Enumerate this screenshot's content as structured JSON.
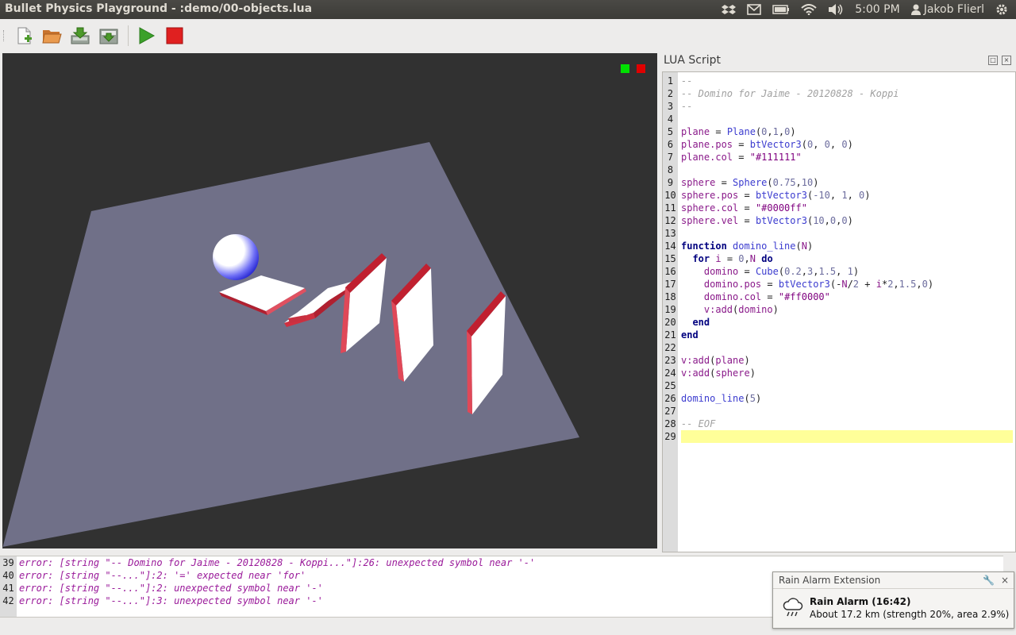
{
  "window": {
    "title": "Bullet Physics Playground - :demo/00-objects.lua"
  },
  "tray": {
    "time": "5:00 PM",
    "user": "Jakob Flierl"
  },
  "toolbar": {
    "buttons": [
      "new-file-icon",
      "open-folder-icon",
      "save-icon",
      "save-as-icon",
      "run-icon",
      "stop-icon"
    ]
  },
  "viewport": {
    "status_colors": [
      "#00ff00",
      "#ff0000"
    ],
    "plane_color": "#6f6f86",
    "sphere_color": "#0000ff",
    "domino_color": "#ff0000"
  },
  "script_panel": {
    "title": "LUA Script",
    "current_line": 29,
    "lines": [
      [
        {
          "c": "com",
          "t": "--"
        }
      ],
      [
        {
          "c": "com",
          "t": "-- Domino for Jaime - 20120828 - Koppi"
        }
      ],
      [
        {
          "c": "com",
          "t": "--"
        }
      ],
      [],
      [
        {
          "c": "id",
          "t": "plane"
        },
        {
          "c": "plain",
          "t": " = "
        },
        {
          "c": "fn",
          "t": "Plane"
        },
        {
          "c": "plain",
          "t": "("
        },
        {
          "c": "num",
          "t": "0"
        },
        {
          "c": "plain",
          "t": ","
        },
        {
          "c": "num",
          "t": "1"
        },
        {
          "c": "plain",
          "t": ","
        },
        {
          "c": "num",
          "t": "0"
        },
        {
          "c": "plain",
          "t": ")"
        }
      ],
      [
        {
          "c": "id",
          "t": "plane.pos"
        },
        {
          "c": "plain",
          "t": " = "
        },
        {
          "c": "fn",
          "t": "btVector3"
        },
        {
          "c": "plain",
          "t": "("
        },
        {
          "c": "num",
          "t": "0"
        },
        {
          "c": "plain",
          "t": ", "
        },
        {
          "c": "num",
          "t": "0"
        },
        {
          "c": "plain",
          "t": ", "
        },
        {
          "c": "num",
          "t": "0"
        },
        {
          "c": "plain",
          "t": ")"
        }
      ],
      [
        {
          "c": "id",
          "t": "plane.col"
        },
        {
          "c": "plain",
          "t": " = "
        },
        {
          "c": "str",
          "t": "\"#111111\""
        }
      ],
      [],
      [
        {
          "c": "id",
          "t": "sphere"
        },
        {
          "c": "plain",
          "t": " = "
        },
        {
          "c": "fn",
          "t": "Sphere"
        },
        {
          "c": "plain",
          "t": "("
        },
        {
          "c": "num",
          "t": "0.75"
        },
        {
          "c": "plain",
          "t": ","
        },
        {
          "c": "num",
          "t": "10"
        },
        {
          "c": "plain",
          "t": ")"
        }
      ],
      [
        {
          "c": "id",
          "t": "sphere.pos"
        },
        {
          "c": "plain",
          "t": " = "
        },
        {
          "c": "fn",
          "t": "btVector3"
        },
        {
          "c": "plain",
          "t": "("
        },
        {
          "c": "num",
          "t": "-10"
        },
        {
          "c": "plain",
          "t": ", "
        },
        {
          "c": "num",
          "t": "1"
        },
        {
          "c": "plain",
          "t": ", "
        },
        {
          "c": "num",
          "t": "0"
        },
        {
          "c": "plain",
          "t": ")"
        }
      ],
      [
        {
          "c": "id",
          "t": "sphere.col"
        },
        {
          "c": "plain",
          "t": " = "
        },
        {
          "c": "str",
          "t": "\"#0000ff\""
        }
      ],
      [
        {
          "c": "id",
          "t": "sphere.vel"
        },
        {
          "c": "plain",
          "t": " = "
        },
        {
          "c": "fn",
          "t": "btVector3"
        },
        {
          "c": "plain",
          "t": "("
        },
        {
          "c": "num",
          "t": "10"
        },
        {
          "c": "plain",
          "t": ","
        },
        {
          "c": "num",
          "t": "0"
        },
        {
          "c": "plain",
          "t": ","
        },
        {
          "c": "num",
          "t": "0"
        },
        {
          "c": "plain",
          "t": ")"
        }
      ],
      [],
      [
        {
          "c": "kw",
          "t": "function"
        },
        {
          "c": "plain",
          "t": " "
        },
        {
          "c": "fn",
          "t": "domino_line"
        },
        {
          "c": "plain",
          "t": "("
        },
        {
          "c": "id",
          "t": "N"
        },
        {
          "c": "plain",
          "t": ")"
        }
      ],
      [
        {
          "c": "plain",
          "t": "  "
        },
        {
          "c": "kw",
          "t": "for"
        },
        {
          "c": "plain",
          "t": " "
        },
        {
          "c": "id",
          "t": "i"
        },
        {
          "c": "plain",
          "t": " = "
        },
        {
          "c": "num",
          "t": "0"
        },
        {
          "c": "plain",
          "t": ","
        },
        {
          "c": "id",
          "t": "N"
        },
        {
          "c": "plain",
          "t": " "
        },
        {
          "c": "kw",
          "t": "do"
        }
      ],
      [
        {
          "c": "plain",
          "t": "    "
        },
        {
          "c": "id",
          "t": "domino"
        },
        {
          "c": "plain",
          "t": " = "
        },
        {
          "c": "fn",
          "t": "Cube"
        },
        {
          "c": "plain",
          "t": "("
        },
        {
          "c": "num",
          "t": "0.2"
        },
        {
          "c": "plain",
          "t": ","
        },
        {
          "c": "num",
          "t": "3"
        },
        {
          "c": "plain",
          "t": ","
        },
        {
          "c": "num",
          "t": "1.5"
        },
        {
          "c": "plain",
          "t": ", "
        },
        {
          "c": "num",
          "t": "1"
        },
        {
          "c": "plain",
          "t": ")"
        }
      ],
      [
        {
          "c": "plain",
          "t": "    "
        },
        {
          "c": "id",
          "t": "domino.pos"
        },
        {
          "c": "plain",
          "t": " = "
        },
        {
          "c": "fn",
          "t": "btVector3"
        },
        {
          "c": "plain",
          "t": "(-"
        },
        {
          "c": "id",
          "t": "N"
        },
        {
          "c": "plain",
          "t": "/"
        },
        {
          "c": "num",
          "t": "2"
        },
        {
          "c": "plain",
          "t": " + "
        },
        {
          "c": "id",
          "t": "i"
        },
        {
          "c": "plain",
          "t": "*"
        },
        {
          "c": "num",
          "t": "2"
        },
        {
          "c": "plain",
          "t": ","
        },
        {
          "c": "num",
          "t": "1.5"
        },
        {
          "c": "plain",
          "t": ","
        },
        {
          "c": "num",
          "t": "0"
        },
        {
          "c": "plain",
          "t": ")"
        }
      ],
      [
        {
          "c": "plain",
          "t": "    "
        },
        {
          "c": "id",
          "t": "domino.col"
        },
        {
          "c": "plain",
          "t": " = "
        },
        {
          "c": "str",
          "t": "\"#ff0000\""
        }
      ],
      [
        {
          "c": "plain",
          "t": "    "
        },
        {
          "c": "id",
          "t": "v:add"
        },
        {
          "c": "plain",
          "t": "("
        },
        {
          "c": "id",
          "t": "domino"
        },
        {
          "c": "plain",
          "t": ")"
        }
      ],
      [
        {
          "c": "plain",
          "t": "  "
        },
        {
          "c": "kw",
          "t": "end"
        }
      ],
      [
        {
          "c": "kw",
          "t": "end"
        }
      ],
      [],
      [
        {
          "c": "id",
          "t": "v:add"
        },
        {
          "c": "plain",
          "t": "("
        },
        {
          "c": "id",
          "t": "plane"
        },
        {
          "c": "plain",
          "t": ")"
        }
      ],
      [
        {
          "c": "id",
          "t": "v:add"
        },
        {
          "c": "plain",
          "t": "("
        },
        {
          "c": "id",
          "t": "sphere"
        },
        {
          "c": "plain",
          "t": ")"
        }
      ],
      [],
      [
        {
          "c": "fn",
          "t": "domino_line"
        },
        {
          "c": "plain",
          "t": "("
        },
        {
          "c": "num",
          "t": "5"
        },
        {
          "c": "plain",
          "t": ")"
        }
      ],
      [],
      [
        {
          "c": "com",
          "t": "-- EOF"
        }
      ],
      []
    ]
  },
  "console": {
    "lines": [
      {
        "n": "39",
        "text": "error: [string \"-- Domino for Jaime - 20120828 - Koppi...\"]:26: unexpected symbol near '-'"
      },
      {
        "n": "40",
        "text": "error: [string \"--...\"]:2: '=' expected near 'for'"
      },
      {
        "n": "41",
        "text": "error: [string \"--...\"]:2: unexpected symbol near '-'"
      },
      {
        "n": "42",
        "text": "error: [string \"--...\"]:3: unexpected symbol near '-'"
      }
    ]
  },
  "notification": {
    "header": "Rain Alarm Extension",
    "title": "Rain Alarm (16:42)",
    "text": "About 17.2 km (strength 20%, area 2.9%)"
  }
}
